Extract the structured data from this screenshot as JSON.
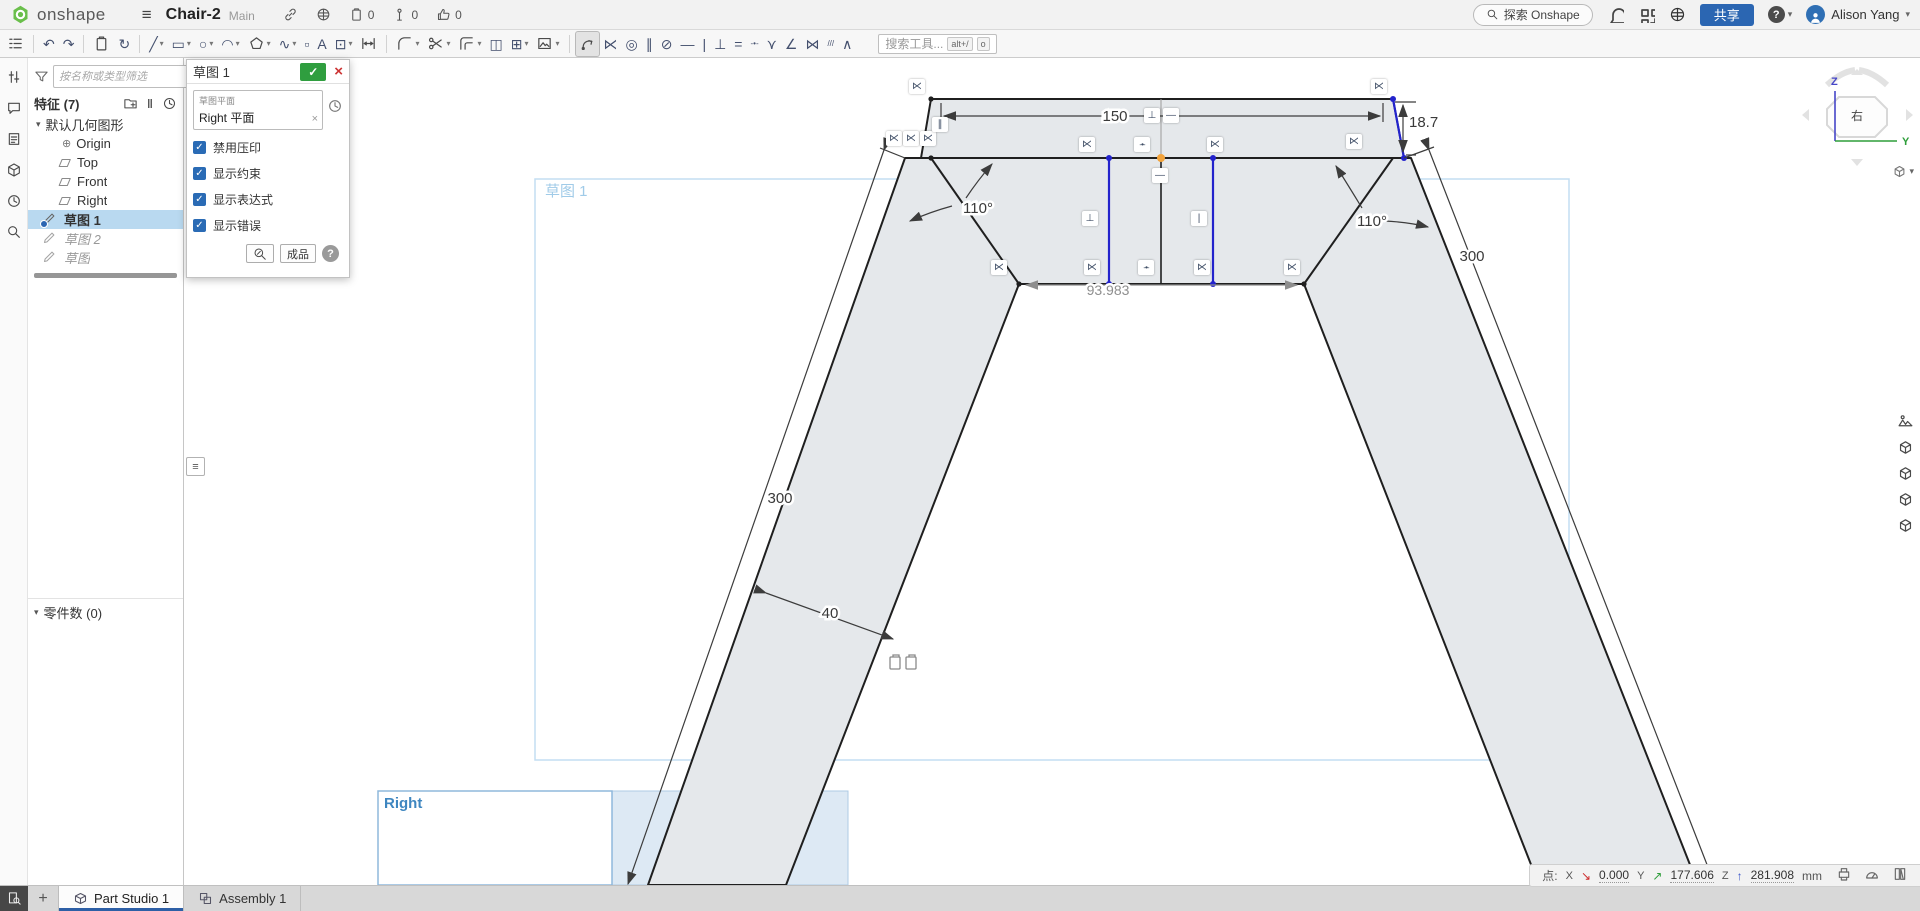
{
  "topbar": {
    "logo_text": "onshape",
    "title": "Chair-2",
    "branch": "Main",
    "meta": [
      {
        "name": "link-icon",
        "svg": "link"
      },
      {
        "name": "public-icon",
        "svg": "globe"
      },
      {
        "name": "copies-icon",
        "svg": "clip",
        "count": "0"
      },
      {
        "name": "followers-icon",
        "svg": "pin",
        "count": "0"
      },
      {
        "name": "likes-icon",
        "svg": "thumb",
        "count": "0"
      }
    ],
    "explore_label": "探索 Onshape",
    "share_label": "共享",
    "user_name": "Alison Yang"
  },
  "toolbar": {
    "search_placeholder": "搜索工具...",
    "kbd1": "alt+/",
    "kbd2": "o",
    "items": [
      {
        "name": "feature-list-toggle",
        "svg": "flist"
      },
      {
        "sep": true
      },
      {
        "name": "undo-button",
        "ch": "↶"
      },
      {
        "name": "redo-button",
        "ch": "↷"
      },
      {
        "sep": true
      },
      {
        "name": "copy-tool",
        "svg": "clip"
      },
      {
        "name": "transform-tool",
        "ch": "↻"
      },
      {
        "sep": true
      },
      {
        "name": "line-tool",
        "ch": "╱",
        "dd": true
      },
      {
        "name": "rectangle-tool",
        "ch": "▭",
        "dd": true
      },
      {
        "name": "circle-tool",
        "ch": "○",
        "dd": true
      },
      {
        "name": "arc-tool",
        "ch": "◠",
        "dd": true
      },
      {
        "name": "polygon-tool",
        "svg": "poly",
        "dd": true
      },
      {
        "name": "spline-tool",
        "ch": "∿",
        "dd": true
      },
      {
        "name": "point-tool",
        "ch": "▫"
      },
      {
        "name": "text-tool",
        "ch": "A"
      },
      {
        "name": "use-convert-tool",
        "ch": "⊡",
        "dd": true
      },
      {
        "name": "dimension-tool",
        "svg": "dim"
      },
      {
        "sep": true
      },
      {
        "name": "fillet-tool",
        "svg": "fillet",
        "dd": true
      },
      {
        "name": "trim-tool",
        "svg": "scissors",
        "dd": true
      },
      {
        "name": "offset-tool",
        "svg": "offset",
        "dd": true
      },
      {
        "name": "mirror-tool",
        "ch": "◫"
      },
      {
        "name": "pattern-tool",
        "ch": "⊞",
        "dd": true
      },
      {
        "name": "insert-image-tool",
        "svg": "image",
        "dd": true
      },
      {
        "sep": true
      },
      {
        "name": "active-sketch-tool",
        "svg": "activetool",
        "active": true
      },
      {
        "name": "coincident-constraint",
        "ch": "⋉",
        "blue": true
      },
      {
        "name": "concentric-constraint",
        "ch": "◎",
        "blue": true
      },
      {
        "name": "parallel-constraint",
        "ch": "∥",
        "blue": true
      },
      {
        "name": "tangent-constraint",
        "ch": "⊘",
        "blue": true
      },
      {
        "name": "horizontal-constraint",
        "ch": "—",
        "blue": true
      },
      {
        "name": "vertical-constraint",
        "ch": "|",
        "blue": true
      },
      {
        "name": "perpendicular-constraint",
        "ch": "⊥",
        "blue": true
      },
      {
        "name": "equal-constraint",
        "ch": "=",
        "blue": true
      },
      {
        "name": "midpoint-constraint",
        "ch": "-•-",
        "small": true,
        "blue": true
      },
      {
        "name": "normal-constraint",
        "ch": "⋎",
        "blue": true
      },
      {
        "name": "pierce-constraint",
        "ch": "∠",
        "blue": true
      },
      {
        "name": "symmetric-constraint",
        "ch": "⋈",
        "blue": true
      },
      {
        "name": "fix-constraint",
        "ch": "///",
        "small": true,
        "blue": true
      },
      {
        "name": "curvature-constraint",
        "ch": "∧",
        "blue": true
      }
    ]
  },
  "strip": [
    {
      "name": "configurations-icon",
      "svg": "sliders"
    },
    {
      "name": "comments-icon",
      "svg": "comment"
    },
    {
      "name": "notes-icon",
      "svg": "note"
    },
    {
      "name": "versions-icon",
      "svg": "cubeq"
    },
    {
      "name": "history-icon",
      "svg": "clock"
    },
    {
      "name": "search-icon",
      "svg": "searchglobe"
    }
  ],
  "panel": {
    "filter_placeholder": "按名称或类型筛选",
    "features_label": "特征 (7)",
    "parts_label": "零件数 (0)",
    "tree": [
      {
        "label": "默认几何图形",
        "type": "group"
      },
      {
        "label": "Origin",
        "type": "origin"
      },
      {
        "label": "Top",
        "type": "plane"
      },
      {
        "label": "Front",
        "type": "plane"
      },
      {
        "label": "Right",
        "type": "plane"
      },
      {
        "label": "草图 1",
        "type": "sketch",
        "state": "selected"
      },
      {
        "label": "草图 2",
        "type": "sketch",
        "state": "suppressed"
      },
      {
        "label": "草图",
        "type": "sketch",
        "state": "suppressed"
      }
    ]
  },
  "dialog": {
    "title": "草图 1",
    "plane_label": "草图平面",
    "plane_value": "Right 平面",
    "checkboxes": [
      "禁用压印",
      "显示约束",
      "显示表达式",
      "显示错误"
    ],
    "final_label": "成品"
  },
  "canvas": {
    "sketch_label": "草图 1",
    "plane_caption": "Right",
    "dims": {
      "width": "150",
      "height": "18.7",
      "angle_left": "110°",
      "angle_right": "110°",
      "len_left": "300",
      "len_right": "300",
      "leg_width": "40",
      "inner": "93.983"
    },
    "badges": [
      [
        918,
        87,
        "⋉"
      ],
      [
        1380,
        87,
        "⋉"
      ],
      [
        895,
        139,
        "⋉"
      ],
      [
        912,
        139,
        "⋉"
      ],
      [
        929,
        139,
        "⋉"
      ],
      [
        941,
        125,
        "∥"
      ],
      [
        1088,
        145,
        "⋉"
      ],
      [
        1143,
        145,
        "-•-"
      ],
      [
        1216,
        145,
        "⋉"
      ],
      [
        1355,
        142,
        "⋉"
      ],
      [
        1153,
        116,
        "⊥"
      ],
      [
        1172,
        116,
        "—"
      ],
      [
        1161,
        176,
        "—"
      ],
      [
        1091,
        219,
        "⊥"
      ],
      [
        1200,
        219,
        "|"
      ],
      [
        1000,
        268,
        "⋉"
      ],
      [
        1093,
        268,
        "⋉"
      ],
      [
        1147,
        268,
        "-•-"
      ],
      [
        1203,
        268,
        "⋉"
      ],
      [
        1293,
        268,
        "⋉"
      ]
    ],
    "view_tools": [
      {
        "name": "scene-view-icon",
        "svg": "scene"
      },
      {
        "name": "view-preset-icon-1",
        "svg": "cube"
      },
      {
        "name": "view-preset-icon-2",
        "svg": "cube"
      },
      {
        "name": "view-preset-icon-3",
        "svg": "cube"
      },
      {
        "name": "view-preset-icon-4",
        "svg": "cube"
      }
    ],
    "colors": {
      "accent_blue": "#2b66b2",
      "selection_blue": "#b9d9f0",
      "sketch_entity_blue": "#2323cc",
      "origin_orange": "#f2a33c",
      "confirm_green": "#2f9e3f",
      "shape_fill": "#e5e8eb"
    }
  },
  "viewcube": {
    "face": "右",
    "axis_z": "Z",
    "axis_y": "Y"
  },
  "status": {
    "point_label": "点:",
    "x_label": "X",
    "x": "0.000",
    "y_label": "Y",
    "y": "177.606",
    "z_label": "Z",
    "z": "281.908",
    "unit": "mm",
    "icons": [
      {
        "name": "printer-icon",
        "svg": "printer"
      },
      {
        "name": "gauge-icon",
        "svg": "gauge"
      },
      {
        "name": "scale-icon",
        "svg": "book"
      }
    ]
  },
  "tabs": [
    {
      "label": "Part Studio 1",
      "active": true,
      "icon": "partstudio"
    },
    {
      "label": "Assembly 1",
      "active": false,
      "icon": "assembly"
    }
  ]
}
